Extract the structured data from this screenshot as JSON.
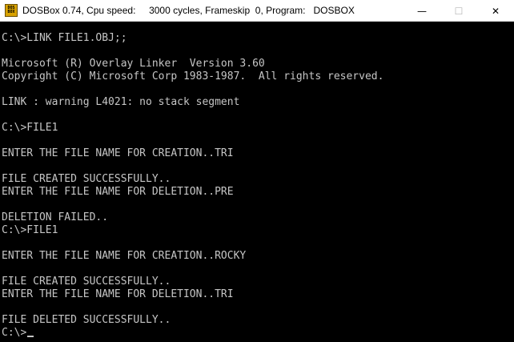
{
  "window": {
    "title": "DOSBox 0.74, Cpu speed:     3000 cycles, Frameskip  0, Program:   DOSBOX",
    "icon_line1": "DOS",
    "icon_line2": "BOX",
    "minimize_glyph": "—",
    "maximize_glyph": "☐",
    "close_glyph": "✕"
  },
  "console": {
    "lines": [
      "C:\\>LINK FILE1.OBJ;;",
      "",
      "Microsoft (R) Overlay Linker  Version 3.60",
      "Copyright (C) Microsoft Corp 1983-1987.  All rights reserved.",
      "",
      "LINK : warning L4021: no stack segment",
      "",
      "C:\\>FILE1",
      "",
      "ENTER THE FILE NAME FOR CREATION..TRI",
      "",
      "FILE CREATED SUCCESSFULLY..",
      "ENTER THE FILE NAME FOR DELETION..PRE",
      "",
      "DELETION FAILED..",
      "C:\\>FILE1",
      "",
      "ENTER THE FILE NAME FOR CREATION..ROCKY",
      "",
      "FILE CREATED SUCCESSFULLY..",
      "ENTER THE FILE NAME FOR DELETION..TRI",
      "",
      "FILE DELETED SUCCESSFULLY..",
      "C:\\>"
    ]
  },
  "colors": {
    "console_bg": "#000000",
    "console_fg": "#c6c6c6",
    "titlebar_bg": "#ffffff"
  }
}
